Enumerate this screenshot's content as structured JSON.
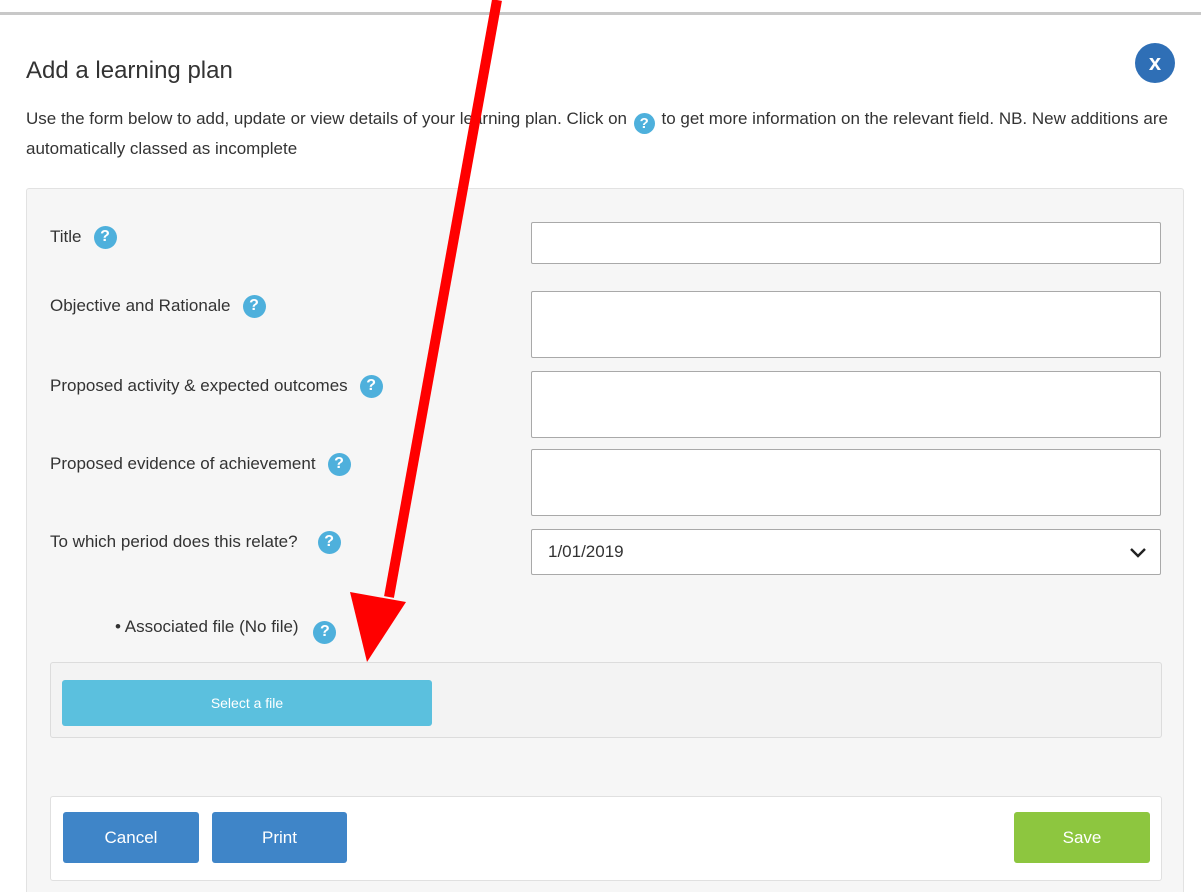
{
  "dialog": {
    "title": "Add a learning plan",
    "close_label": "x",
    "intro_before_icon": "Use the form below to add, update or view details of your learning plan. Click on",
    "intro_after_icon": "to get more information on the relevant field. NB. New additions are automatically classed as incomplete"
  },
  "help_icon_glyph": "?",
  "form": {
    "fields": [
      {
        "label": "Title",
        "value": ""
      },
      {
        "label": "Objective and Rationale",
        "value": ""
      },
      {
        "label": "Proposed activity & expected outcomes",
        "value": ""
      },
      {
        "label": "Proposed evidence of achievement",
        "value": ""
      }
    ],
    "period": {
      "label": "To which period does this relate?",
      "selected": "1/01/2019"
    },
    "file": {
      "label": "• Associated file (No file)",
      "select_label": "Select a file"
    }
  },
  "actions": {
    "cancel": "Cancel",
    "print": "Print",
    "save": "Save"
  },
  "colors": {
    "primary_button": "#3f85c8",
    "save_button": "#8dc63f",
    "file_button": "#5bc0de",
    "help_icon": "#4eb0dc",
    "close_button": "#2f6fb6",
    "annotation_arrow": "#ff0000"
  }
}
